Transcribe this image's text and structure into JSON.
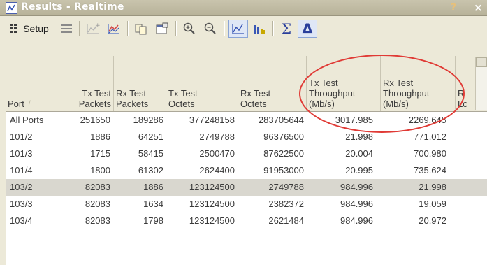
{
  "window": {
    "title": "Results - Realtime",
    "help_glyph": "?",
    "close_glyph": "×"
  },
  "toolbar": {
    "setup_label": "Setup",
    "icons": [
      "setup-icon",
      "list-icon",
      "add-chart-icon",
      "line-chart-icon",
      "copy-icon",
      "properties-icon",
      "zoom-in-icon",
      "zoom-out-icon",
      "line-chart-view-icon",
      "bar-chart-view-icon",
      "sigma-icon",
      "delta-icon"
    ],
    "sigma_glyph": "Σ",
    "delta_glyph": "Δ"
  },
  "grid": {
    "columns": [
      {
        "key": "port",
        "label": "Port",
        "sort_glyph": "/"
      },
      {
        "key": "tx_pkts",
        "label": "Tx Test\nPackets"
      },
      {
        "key": "rx_pkts",
        "label": "Rx Test\nPackets"
      },
      {
        "key": "tx_oct",
        "label": "Tx Test\nOctets"
      },
      {
        "key": "rx_oct",
        "label": "Rx Test\nOctets"
      },
      {
        "key": "tx_tp",
        "label": "Tx Test\nThroughput\n(Mb/s)"
      },
      {
        "key": "rx_tp",
        "label": "Rx Test\nThroughput\n(Mb/s)"
      },
      {
        "key": "rx_lc",
        "label": "R\nLc"
      }
    ],
    "rows": [
      {
        "port": "All Ports",
        "tx_pkts": "251650",
        "rx_pkts": "189286",
        "tx_oct": "377248158",
        "rx_oct": "283705644",
        "tx_tp": "3017.985",
        "rx_tp": "2269.645",
        "selected": false
      },
      {
        "port": "101/2",
        "tx_pkts": "1886",
        "rx_pkts": "64251",
        "tx_oct": "2749788",
        "rx_oct": "96376500",
        "tx_tp": "21.998",
        "rx_tp": "771.012",
        "selected": false
      },
      {
        "port": "101/3",
        "tx_pkts": "1715",
        "rx_pkts": "58415",
        "tx_oct": "2500470",
        "rx_oct": "87622500",
        "tx_tp": "20.004",
        "rx_tp": "700.980",
        "selected": false
      },
      {
        "port": "101/4",
        "tx_pkts": "1800",
        "rx_pkts": "61302",
        "tx_oct": "2624400",
        "rx_oct": "91953000",
        "tx_tp": "20.995",
        "rx_tp": "735.624",
        "selected": false
      },
      {
        "port": "103/2",
        "tx_pkts": "82083",
        "rx_pkts": "1886",
        "tx_oct": "123124500",
        "rx_oct": "2749788",
        "tx_tp": "984.996",
        "rx_tp": "21.998",
        "selected": true
      },
      {
        "port": "103/3",
        "tx_pkts": "82083",
        "rx_pkts": "1634",
        "tx_oct": "123124500",
        "rx_oct": "2382372",
        "tx_tp": "984.996",
        "rx_tp": "19.059",
        "selected": false
      },
      {
        "port": "103/4",
        "tx_pkts": "82083",
        "rx_pkts": "1798",
        "tx_oct": "123124500",
        "rx_oct": "2621484",
        "tx_tp": "984.996",
        "rx_tp": "20.972",
        "selected": false
      }
    ]
  },
  "colors": {
    "highlight": "#e03a35",
    "selected_row": "#d9d7cf"
  }
}
